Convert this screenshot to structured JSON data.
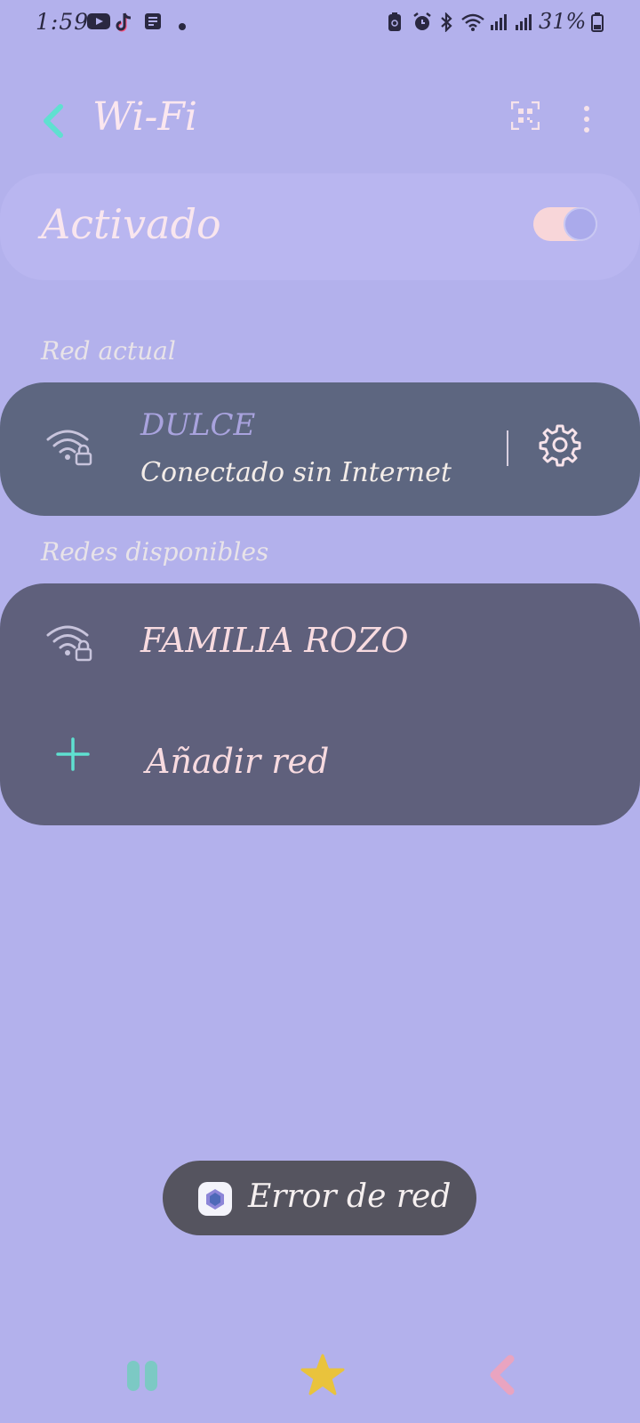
{
  "status_bar": {
    "time": "1:59",
    "left_icons": [
      "youtube-icon",
      "tiktok-icon",
      "notes-icon",
      "dot-icon"
    ],
    "right_icons": [
      "battery-saver-icon",
      "alarm-icon",
      "bluetooth-icon",
      "wifi-icon",
      "signal-icon",
      "signal-icon"
    ],
    "battery": "31%"
  },
  "header": {
    "title": "Wi-Fi",
    "icons": [
      "back-icon",
      "qr-code-icon",
      "more-options-icon"
    ]
  },
  "toggle": {
    "label": "Activado",
    "state": "on"
  },
  "current_network": {
    "section_label": "Red actual",
    "name": "DULCE",
    "status": "Conectado sin Internet",
    "icon": "wifi-lock-icon"
  },
  "available_networks": {
    "section_label": "Redes disponibles",
    "items": [
      {
        "name": "FAMILIA ROZO",
        "icon": "wifi-lock-icon"
      }
    ],
    "add_label": "Añadir red"
  },
  "toast": {
    "text": "Error de red"
  },
  "nav_bar": {
    "buttons": [
      "recents-button",
      "home-button",
      "back-button"
    ]
  },
  "colors": {
    "background": "#b3b1ec",
    "toggle_card": "#b9b6f0",
    "current_card": "#5d6680",
    "available_card": "#5f607c",
    "accent_teal": "#5fe0d0",
    "title_pink": "#fbe7ef",
    "toast": "#55545f"
  }
}
